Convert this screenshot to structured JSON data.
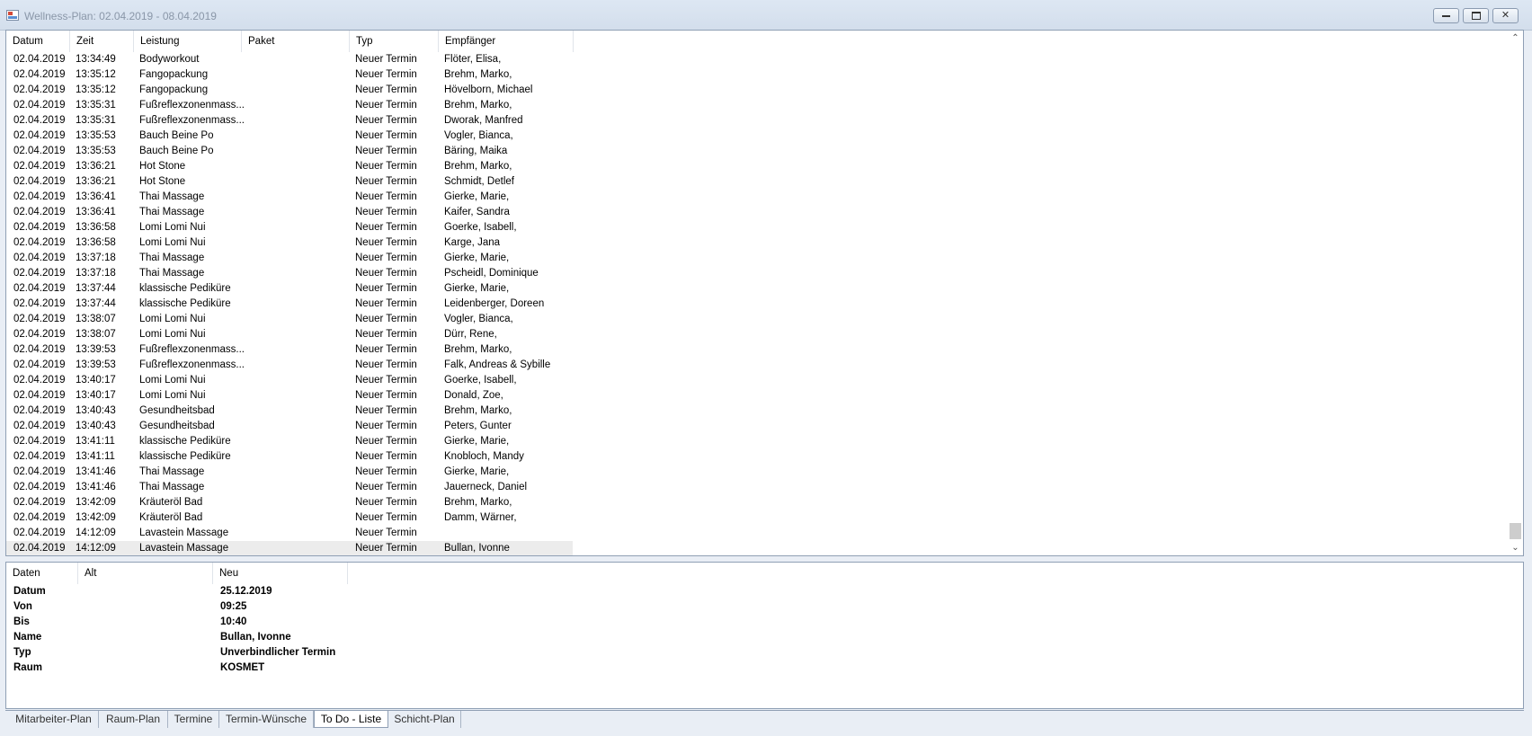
{
  "window": {
    "title": "Wellness-Plan: 02.04.2019 - 08.04.2019",
    "buttons": {
      "minimize": "minimize-icon",
      "maximize": "maximize-icon",
      "close": "✕"
    }
  },
  "log_table": {
    "columns": [
      "Datum",
      "Zeit",
      "Leistung",
      "Paket",
      "Typ",
      "Empfänger"
    ],
    "rows": [
      {
        "datum": "02.04.2019",
        "zeit": "13:34:49",
        "leistung": "Bodyworkout",
        "paket": "",
        "typ": "Neuer Termin",
        "empfaenger": "Flöter, Elisa,"
      },
      {
        "datum": "02.04.2019",
        "zeit": "13:35:12",
        "leistung": "Fangopackung",
        "paket": "",
        "typ": "Neuer Termin",
        "empfaenger": "Brehm, Marko,"
      },
      {
        "datum": "02.04.2019",
        "zeit": "13:35:12",
        "leistung": "Fangopackung",
        "paket": "",
        "typ": "Neuer Termin",
        "empfaenger": "Hövelborn, Michael"
      },
      {
        "datum": "02.04.2019",
        "zeit": "13:35:31",
        "leistung": "Fußreflexzonenmass...",
        "paket": "",
        "typ": "Neuer Termin",
        "empfaenger": "Brehm, Marko,"
      },
      {
        "datum": "02.04.2019",
        "zeit": "13:35:31",
        "leistung": "Fußreflexzonenmass...",
        "paket": "",
        "typ": "Neuer Termin",
        "empfaenger": "Dworak, Manfred"
      },
      {
        "datum": "02.04.2019",
        "zeit": "13:35:53",
        "leistung": "Bauch Beine Po",
        "paket": "",
        "typ": "Neuer Termin",
        "empfaenger": "Vogler, Bianca,"
      },
      {
        "datum": "02.04.2019",
        "zeit": "13:35:53",
        "leistung": "Bauch Beine Po",
        "paket": "",
        "typ": "Neuer Termin",
        "empfaenger": "Bäring, Maika"
      },
      {
        "datum": "02.04.2019",
        "zeit": "13:36:21",
        "leistung": "Hot Stone",
        "paket": "",
        "typ": "Neuer Termin",
        "empfaenger": "Brehm, Marko,"
      },
      {
        "datum": "02.04.2019",
        "zeit": "13:36:21",
        "leistung": "Hot Stone",
        "paket": "",
        "typ": "Neuer Termin",
        "empfaenger": "Schmidt, Detlef"
      },
      {
        "datum": "02.04.2019",
        "zeit": "13:36:41",
        "leistung": "Thai Massage",
        "paket": "",
        "typ": "Neuer Termin",
        "empfaenger": "Gierke, Marie,"
      },
      {
        "datum": "02.04.2019",
        "zeit": "13:36:41",
        "leistung": "Thai Massage",
        "paket": "",
        "typ": "Neuer Termin",
        "empfaenger": "Kaifer, Sandra"
      },
      {
        "datum": "02.04.2019",
        "zeit": "13:36:58",
        "leistung": "Lomi Lomi Nui",
        "paket": "",
        "typ": "Neuer Termin",
        "empfaenger": "Goerke, Isabell,"
      },
      {
        "datum": "02.04.2019",
        "zeit": "13:36:58",
        "leistung": "Lomi Lomi Nui",
        "paket": "",
        "typ": "Neuer Termin",
        "empfaenger": "Karge, Jana"
      },
      {
        "datum": "02.04.2019",
        "zeit": "13:37:18",
        "leistung": "Thai Massage",
        "paket": "",
        "typ": "Neuer Termin",
        "empfaenger": "Gierke, Marie,"
      },
      {
        "datum": "02.04.2019",
        "zeit": "13:37:18",
        "leistung": "Thai Massage",
        "paket": "",
        "typ": "Neuer Termin",
        "empfaenger": "Pscheidl, Dominique"
      },
      {
        "datum": "02.04.2019",
        "zeit": "13:37:44",
        "leistung": "klassische Pediküre",
        "paket": "",
        "typ": "Neuer Termin",
        "empfaenger": "Gierke, Marie,"
      },
      {
        "datum": "02.04.2019",
        "zeit": "13:37:44",
        "leistung": "klassische Pediküre",
        "paket": "",
        "typ": "Neuer Termin",
        "empfaenger": "Leidenberger, Doreen"
      },
      {
        "datum": "02.04.2019",
        "zeit": "13:38:07",
        "leistung": "Lomi Lomi Nui",
        "paket": "",
        "typ": "Neuer Termin",
        "empfaenger": "Vogler, Bianca,"
      },
      {
        "datum": "02.04.2019",
        "zeit": "13:38:07",
        "leistung": "Lomi Lomi Nui",
        "paket": "",
        "typ": "Neuer Termin",
        "empfaenger": "Dürr, Rene,"
      },
      {
        "datum": "02.04.2019",
        "zeit": "13:39:53",
        "leistung": "Fußreflexzonenmass...",
        "paket": "",
        "typ": "Neuer Termin",
        "empfaenger": "Brehm, Marko,"
      },
      {
        "datum": "02.04.2019",
        "zeit": "13:39:53",
        "leistung": "Fußreflexzonenmass...",
        "paket": "",
        "typ": "Neuer Termin",
        "empfaenger": "Falk, Andreas & Sybille"
      },
      {
        "datum": "02.04.2019",
        "zeit": "13:40:17",
        "leistung": "Lomi Lomi Nui",
        "paket": "",
        "typ": "Neuer Termin",
        "empfaenger": "Goerke, Isabell,"
      },
      {
        "datum": "02.04.2019",
        "zeit": "13:40:17",
        "leistung": "Lomi Lomi Nui",
        "paket": "",
        "typ": "Neuer Termin",
        "empfaenger": "Donald, Zoe,"
      },
      {
        "datum": "02.04.2019",
        "zeit": "13:40:43",
        "leistung": "Gesundheitsbad",
        "paket": "",
        "typ": "Neuer Termin",
        "empfaenger": "Brehm, Marko,"
      },
      {
        "datum": "02.04.2019",
        "zeit": "13:40:43",
        "leistung": "Gesundheitsbad",
        "paket": "",
        "typ": "Neuer Termin",
        "empfaenger": "Peters, Gunter"
      },
      {
        "datum": "02.04.2019",
        "zeit": "13:41:11",
        "leistung": "klassische Pediküre",
        "paket": "",
        "typ": "Neuer Termin",
        "empfaenger": "Gierke, Marie,"
      },
      {
        "datum": "02.04.2019",
        "zeit": "13:41:11",
        "leistung": "klassische Pediküre",
        "paket": "",
        "typ": "Neuer Termin",
        "empfaenger": "Knobloch, Mandy"
      },
      {
        "datum": "02.04.2019",
        "zeit": "13:41:46",
        "leistung": "Thai Massage",
        "paket": "",
        "typ": "Neuer Termin",
        "empfaenger": "Gierke, Marie,"
      },
      {
        "datum": "02.04.2019",
        "zeit": "13:41:46",
        "leistung": "Thai Massage",
        "paket": "",
        "typ": "Neuer Termin",
        "empfaenger": "Jauerneck, Daniel"
      },
      {
        "datum": "02.04.2019",
        "zeit": "13:42:09",
        "leistung": "Kräuteröl Bad",
        "paket": "",
        "typ": "Neuer Termin",
        "empfaenger": "Brehm, Marko,"
      },
      {
        "datum": "02.04.2019",
        "zeit": "13:42:09",
        "leistung": "Kräuteröl Bad",
        "paket": "",
        "typ": "Neuer Termin",
        "empfaenger": "Damm, Wärner,"
      },
      {
        "datum": "02.04.2019",
        "zeit": "14:12:09",
        "leistung": "Lavastein Massage",
        "paket": "",
        "typ": "Neuer Termin",
        "empfaenger": ""
      },
      {
        "datum": "02.04.2019",
        "zeit": "14:12:09",
        "leistung": "Lavastein Massage",
        "paket": "",
        "typ": "Neuer Termin",
        "empfaenger": "Bullan, Ivonne",
        "selected": true
      }
    ]
  },
  "detail_table": {
    "columns": [
      "Daten",
      "Alt",
      "Neu"
    ],
    "rows": [
      {
        "label": "Datum",
        "alt": "",
        "neu": "25.12.2019"
      },
      {
        "label": "Von",
        "alt": "",
        "neu": "09:25"
      },
      {
        "label": "Bis",
        "alt": "",
        "neu": "10:40"
      },
      {
        "label": "Name",
        "alt": "",
        "neu": "Bullan, Ivonne"
      },
      {
        "label": "Typ",
        "alt": "",
        "neu": "Unverbindlicher Termin"
      },
      {
        "label": "Raum",
        "alt": "",
        "neu": "KOSMET"
      }
    ]
  },
  "tabs": [
    {
      "label": "Mitarbeiter-Plan",
      "active": false
    },
    {
      "label": "Raum-Plan",
      "active": false
    },
    {
      "label": "Termine",
      "active": false
    },
    {
      "label": "Termin-Wünsche",
      "active": false
    },
    {
      "label": "To Do - Liste",
      "active": true
    },
    {
      "label": "Schicht-Plan",
      "active": false
    }
  ],
  "colors": {
    "background": "#e9eef5",
    "selected_row": "#ececec",
    "border": "#8f9fb4"
  }
}
